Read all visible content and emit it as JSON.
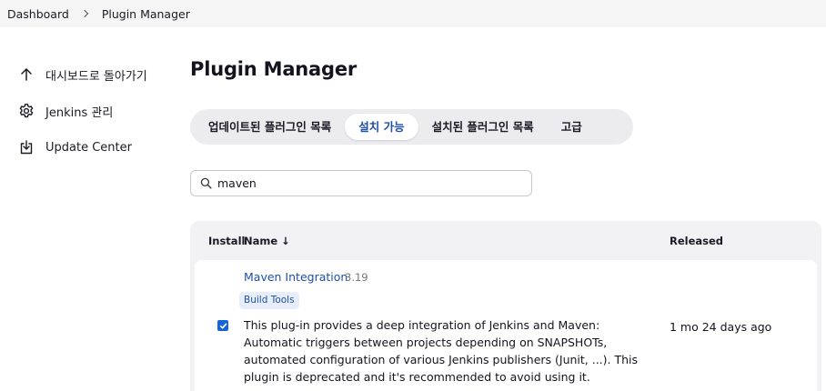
{
  "breadcrumb": {
    "items": [
      "Dashboard",
      "Plugin Manager"
    ]
  },
  "sidebar": {
    "items": [
      {
        "label": "대시보드로 돌아가기",
        "icon": "arrow-up-icon"
      },
      {
        "label": "Jenkins 관리",
        "icon": "gear-icon"
      },
      {
        "label": "Update Center",
        "icon": "download-icon"
      }
    ]
  },
  "main": {
    "title": "Plugin Manager",
    "tabs": [
      {
        "label": "업데이트된 플러그인 목록",
        "active": false
      },
      {
        "label": "설치 가능",
        "active": true
      },
      {
        "label": "설치된 플러그인 목록",
        "active": false
      },
      {
        "label": "고급",
        "active": false
      }
    ],
    "search": {
      "value": "maven"
    }
  },
  "table": {
    "headers": {
      "install": "Install",
      "name": "Name ↓",
      "released": "Released"
    },
    "rows": [
      {
        "name": "Maven Integration",
        "version": "3.19",
        "tag": "Build Tools",
        "checked": true,
        "description": "This plug-in provides a deep integration of Jenkins and Maven: Automatic triggers between projects depending on SNAPSHOTs, automated configuration of various Jenkins publishers (Junit, ...). This plugin is deprecated and it's recommended to avoid using it.",
        "released": "1 mo 24 days ago"
      }
    ]
  },
  "colors": {
    "accent": "#1f4fa8",
    "checkbox": "#1565d8"
  }
}
